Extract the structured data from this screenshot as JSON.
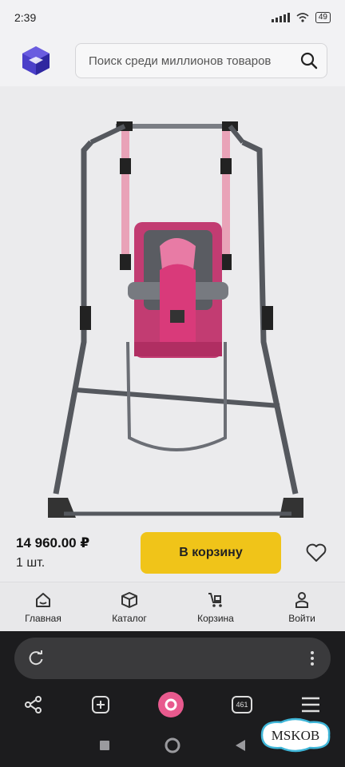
{
  "status_bar": {
    "time": "2:39",
    "battery": "49"
  },
  "header": {
    "search_placeholder": "Поиск среди миллионов товаров"
  },
  "product": {
    "price": "14 960.00 ₽",
    "quantity": "1 шт.",
    "add_to_cart_label": "В корзину"
  },
  "bottom_nav": {
    "items": [
      {
        "label": "Главная",
        "icon": "home-icon"
      },
      {
        "label": "Каталог",
        "icon": "catalog-box-icon"
      },
      {
        "label": "Корзина",
        "icon": "cart-icon"
      },
      {
        "label": "Войти",
        "icon": "user-icon"
      }
    ]
  },
  "browser": {
    "tabs_count": "461"
  },
  "watermark": {
    "text": "MSKOB"
  },
  "colors": {
    "accent_yellow": "#f0c419",
    "alice_pink": "#e85a8e"
  }
}
